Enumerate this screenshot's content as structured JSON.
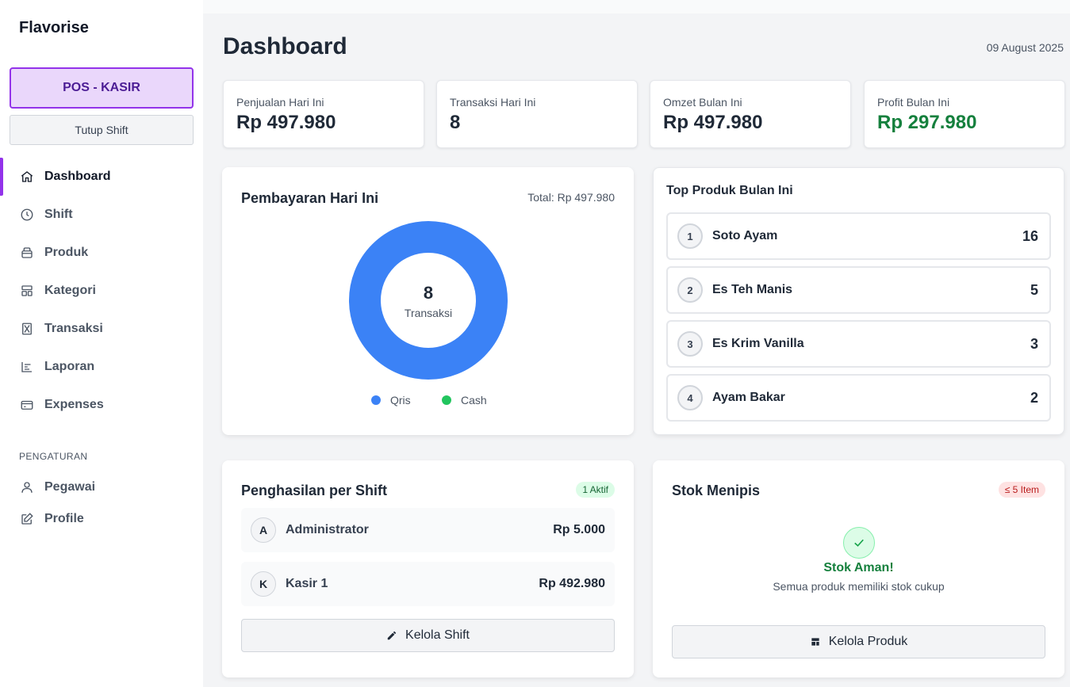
{
  "sidebar": {
    "brand": "Flavorise",
    "pos_button": "POS - KASIR",
    "close_shift_button": "Tutup Shift",
    "nav": [
      {
        "label": "Dashboard",
        "icon": "home-icon",
        "active": true
      },
      {
        "label": "Shift",
        "icon": "clock-icon"
      },
      {
        "label": "Produk",
        "icon": "box-icon"
      },
      {
        "label": "Kategori",
        "icon": "category-icon"
      },
      {
        "label": "Transaksi",
        "icon": "hourglass-icon"
      },
      {
        "label": "Laporan",
        "icon": "chart-icon"
      },
      {
        "label": "Expenses",
        "icon": "card-icon"
      }
    ],
    "settings_label": "PENGATURAN",
    "settings_nav": [
      {
        "label": "Pegawai",
        "icon": "user-icon"
      },
      {
        "label": "Profile",
        "icon": "edit-icon"
      }
    ]
  },
  "header": {
    "title": "Dashboard",
    "date": "09 August 2025"
  },
  "stats": [
    {
      "label": "Penjualan Hari Ini",
      "value": "Rp 497.980"
    },
    {
      "label": "Transaksi Hari Ini",
      "value": "8"
    },
    {
      "label": "Omzet Bulan Ini",
      "value": "Rp 497.980"
    },
    {
      "label": "Profit Bulan Ini",
      "value": "Rp 297.980",
      "color": "#15803d"
    }
  ],
  "payments": {
    "title": "Pembayaran Hari Ini",
    "total": "Total: Rp 497.980",
    "center_value": "8",
    "center_label": "Transaksi",
    "legend": [
      {
        "label": "Qris",
        "color": "#3b82f6"
      },
      {
        "label": "Cash",
        "color": "#22c55e"
      }
    ]
  },
  "chart_data": {
    "type": "pie",
    "categories": [
      "Qris",
      "Cash"
    ],
    "values": [
      8,
      0
    ],
    "colors": [
      "#3b82f6",
      "#22c55e"
    ]
  },
  "top_products": {
    "title": "Top Produk Bulan Ini",
    "items": [
      {
        "rank": "1",
        "name": "Soto Ayam",
        "qty": "16"
      },
      {
        "rank": "2",
        "name": "Es Teh Manis",
        "qty": "5"
      },
      {
        "rank": "3",
        "name": "Es Krim Vanilla",
        "qty": "3"
      },
      {
        "rank": "4",
        "name": "Ayam Bakar",
        "qty": "2"
      }
    ]
  },
  "shift_income": {
    "title": "Penghasilan per Shift",
    "badge": "1 Aktif",
    "rows": [
      {
        "initial": "A",
        "name": "Administrator",
        "amount": "Rp 5.000"
      },
      {
        "initial": "K",
        "name": "Kasir 1",
        "amount": "Rp 492.980"
      }
    ],
    "button": "Kelola Shift"
  },
  "low_stock": {
    "title": "Stok Menipis",
    "badge": "≤ 5 Item",
    "status_title": "Stok Aman!",
    "status_sub": "Semua produk memiliki stok cukup",
    "button": "Kelola Produk"
  }
}
